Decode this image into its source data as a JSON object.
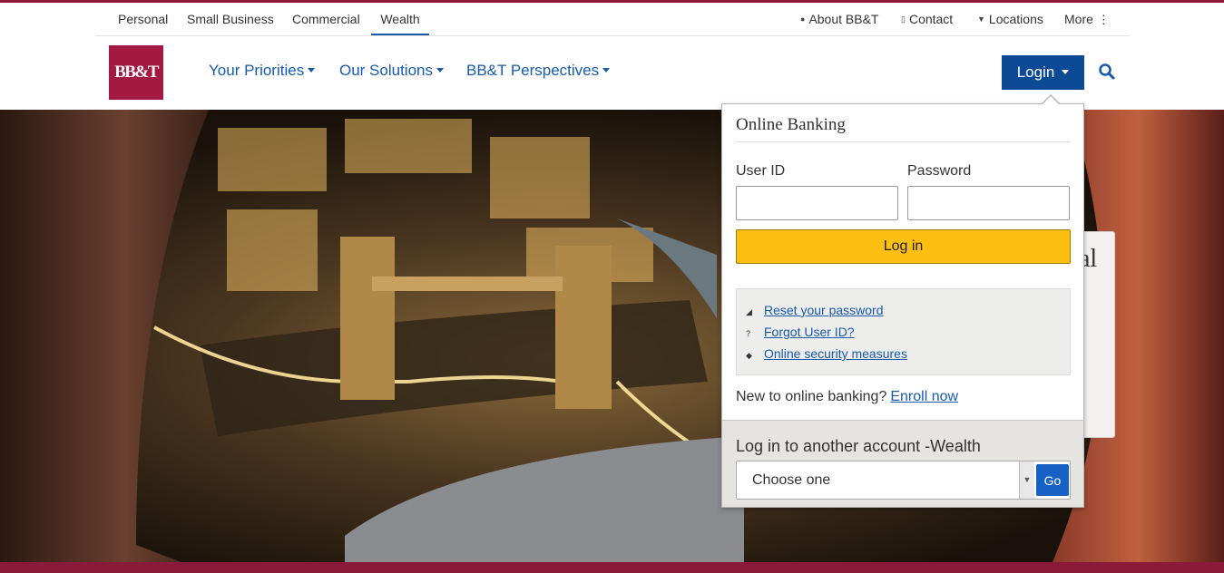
{
  "utility_nav": {
    "segments": [
      {
        "label": "Personal",
        "active": false
      },
      {
        "label": "Small Business",
        "active": false
      },
      {
        "label": "Commercial",
        "active": false
      },
      {
        "label": "Wealth",
        "active": true
      }
    ],
    "links": [
      {
        "label": "About BB&T",
        "icon": "person-icon"
      },
      {
        "label": "Contact",
        "icon": "phone-icon"
      },
      {
        "label": "Locations",
        "icon": "map-pin-icon"
      },
      {
        "label": "More",
        "icon": "vertical-ellipsis-icon"
      }
    ]
  },
  "header": {
    "logo_text": "BB&T",
    "nav": [
      {
        "label": "Your Priorities"
      },
      {
        "label": "Our Solutions"
      },
      {
        "label": "BB&T Perspectives"
      }
    ],
    "login_label": "Login",
    "search_icon": "search-icon"
  },
  "hero": {
    "card_text": "al"
  },
  "login_panel": {
    "title": "Online Banking",
    "user_id_label": "User ID",
    "user_id_value": "",
    "password_label": "Password",
    "password_value": "",
    "submit_label": "Log in",
    "help_links": [
      {
        "label": "Reset your password",
        "icon": "key-icon"
      },
      {
        "label": "Forgot User ID?",
        "icon": "question-icon"
      },
      {
        "label": "Online security measures",
        "icon": "shield-icon"
      }
    ],
    "enroll_prompt": "New to online banking?",
    "enroll_link": "Enroll now",
    "other_account_label": "Log in to another account -Wealth",
    "other_account_select": "Choose one",
    "go_label": "Go"
  },
  "colors": {
    "brand_burgundy": "#a21942",
    "link_blue": "#1a5aa8",
    "login_blue": "#0d4a96",
    "submit_yellow": "#fdbf12",
    "go_blue": "#1760c4"
  }
}
